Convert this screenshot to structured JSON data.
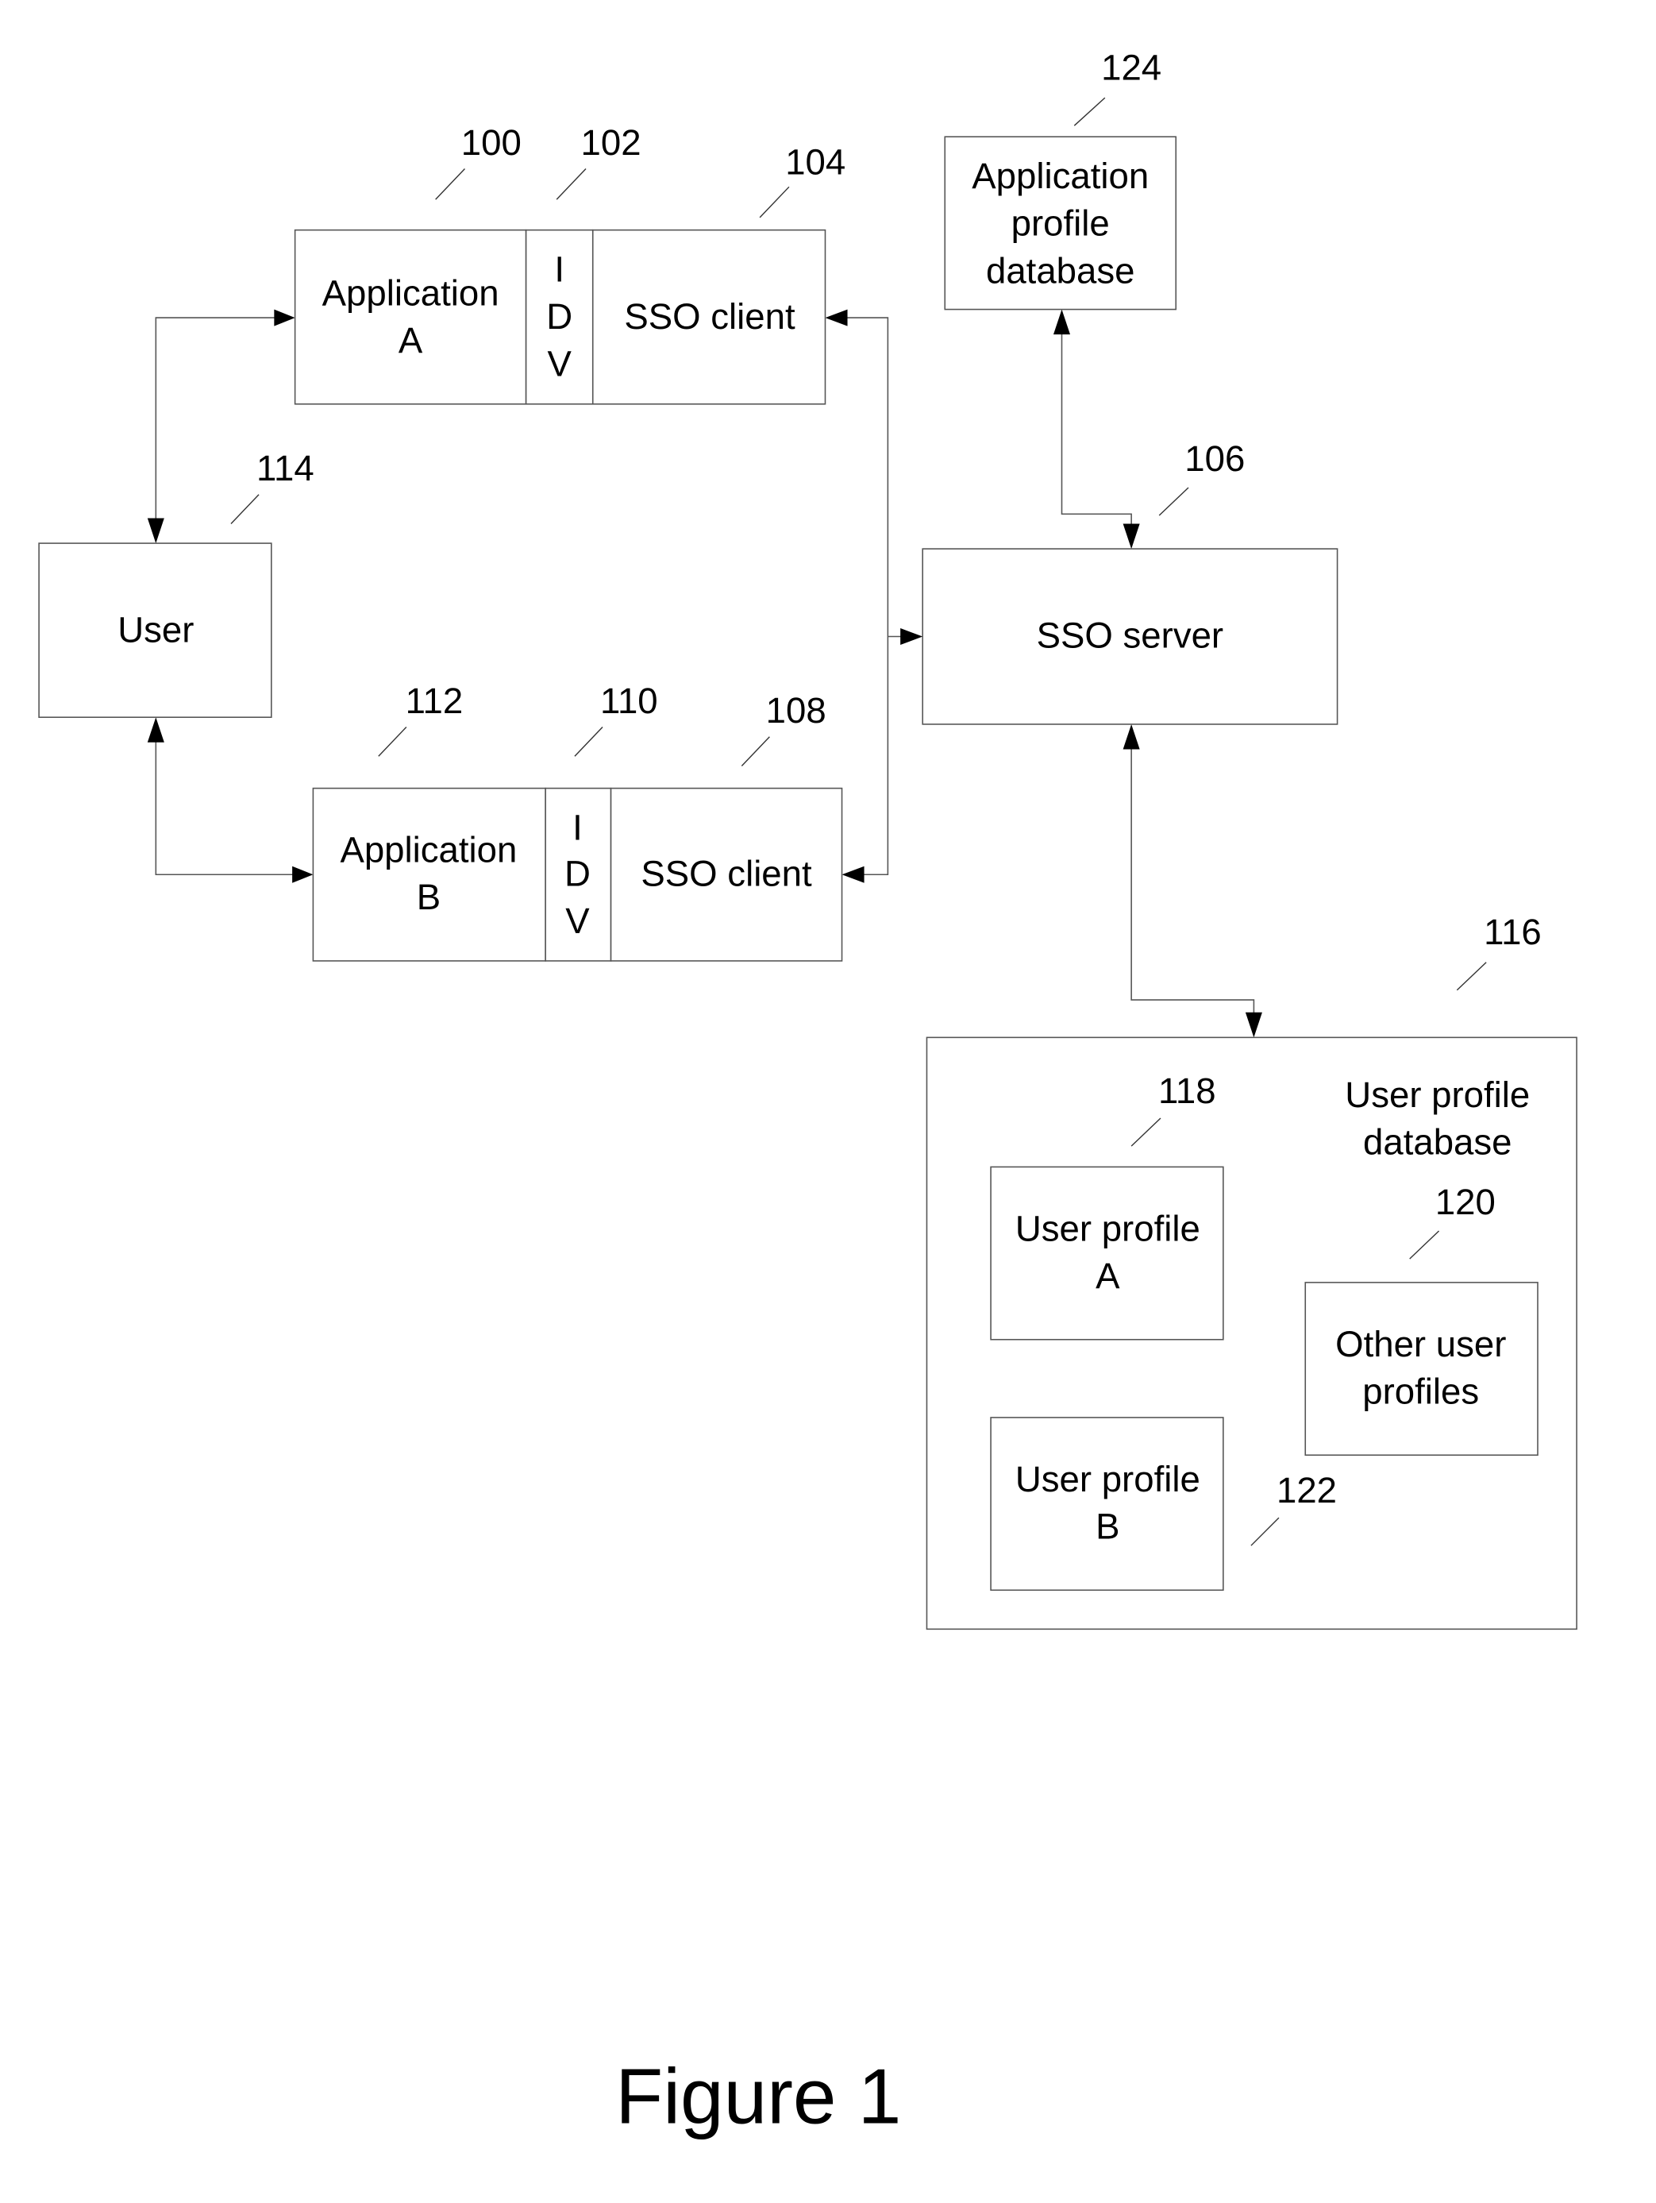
{
  "figure": {
    "caption": "Figure 1"
  },
  "blocks": {
    "application_a": {
      "ref": "100",
      "lines": [
        "Application",
        "A"
      ]
    },
    "idv_a": {
      "ref": "102",
      "lines": [
        "I",
        "D",
        "V"
      ]
    },
    "sso_client_a": {
      "ref": "104",
      "lines": [
        "SSO client"
      ]
    },
    "sso_server": {
      "ref": "106",
      "lines": [
        "SSO server"
      ]
    },
    "sso_client_b": {
      "ref": "108",
      "lines": [
        "SSO client"
      ]
    },
    "idv_b": {
      "ref": "110",
      "lines": [
        "I",
        "D",
        "V"
      ]
    },
    "application_b": {
      "ref": "112",
      "lines": [
        "Application",
        "B"
      ]
    },
    "user": {
      "ref": "114",
      "lines": [
        "User"
      ]
    },
    "user_profile_database": {
      "ref": "116",
      "lines": [
        "User profile",
        "database"
      ]
    },
    "user_profile_a": {
      "ref": "118",
      "lines": [
        "User profile",
        "A"
      ]
    },
    "other_user_profiles": {
      "ref": "120",
      "lines": [
        "Other user",
        "profiles"
      ]
    },
    "user_profile_b": {
      "ref": "122",
      "lines": [
        "User profile",
        "B"
      ]
    },
    "application_profile_database": {
      "ref": "124",
      "lines": [
        "Application",
        "profile",
        "database"
      ]
    }
  },
  "connections": [
    {
      "from": "user",
      "to": "application_a",
      "bidirectional": true
    },
    {
      "from": "user",
      "to": "application_b",
      "bidirectional": true
    },
    {
      "from": "sso_client_a",
      "to": "sso_server",
      "bidirectional": true
    },
    {
      "from": "sso_client_b",
      "to": "sso_server",
      "bidirectional": true
    },
    {
      "from": "sso_server",
      "to": "application_profile_database",
      "bidirectional": true
    },
    {
      "from": "sso_server",
      "to": "user_profile_database",
      "bidirectional": true
    },
    {
      "from": "user_profile_a",
      "to": "user_profile_b",
      "bidirectional": true
    }
  ]
}
